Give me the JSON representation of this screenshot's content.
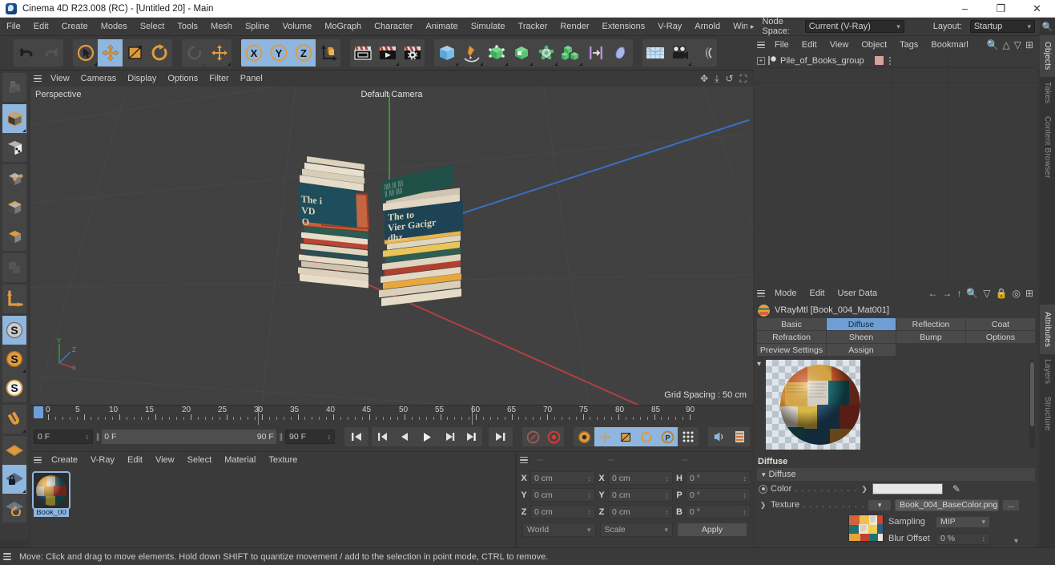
{
  "titlebar": {
    "title": "Cinema 4D R23.008 (RC) - [Untitled 20] - Main",
    "minimize": "–",
    "maximize": "❐",
    "close": "✕"
  },
  "menubar": {
    "items": [
      "File",
      "Edit",
      "Create",
      "Modes",
      "Select",
      "Tools",
      "Mesh",
      "Spline",
      "Volume",
      "MoGraph",
      "Character",
      "Animate",
      "Simulate",
      "Tracker",
      "Render",
      "Extensions",
      "V-Ray",
      "Arnold",
      "Wind"
    ],
    "overflow_arrow": "▸",
    "node_space_label": "Node Space:",
    "node_space_value": "Current (V-Ray)",
    "layout_label": "Layout:",
    "layout_value": "Startup",
    "search_icon": "search-icon"
  },
  "toolbar": {
    "icons": [
      {
        "name": "undo-icon",
        "sel": false,
        "dis": false
      },
      {
        "name": "redo-icon",
        "sel": false,
        "dis": true
      },
      {
        "name": "selection-tool-icon",
        "sel": false,
        "dis": false
      },
      {
        "name": "move-tool-icon",
        "sel": true,
        "dis": false
      },
      {
        "name": "scale-tool-icon",
        "sel": false,
        "dis": false
      },
      {
        "name": "rotate-tool-icon",
        "sel": false,
        "dis": false
      },
      {
        "name": "world-axis-icon",
        "sel": false,
        "dis": true
      },
      {
        "name": "coordinate-move-icon",
        "sel": false,
        "dis": false
      },
      {
        "name": "x-axis-lock-icon",
        "sel": true,
        "dis": false
      },
      {
        "name": "y-axis-lock-icon",
        "sel": true,
        "dis": false
      },
      {
        "name": "z-axis-lock-icon",
        "sel": true,
        "dis": false
      },
      {
        "name": "object-world-axis-icon",
        "sel": false,
        "dis": false
      },
      {
        "name": "render-view-icon",
        "sel": false,
        "dis": false
      },
      {
        "name": "render-to-picture-viewer-icon",
        "sel": false,
        "dis": false
      },
      {
        "name": "render-settings-icon",
        "sel": false,
        "dis": false
      },
      {
        "name": "cube-primitive-icon",
        "sel": false,
        "dis": false
      },
      {
        "name": "spline-pen-icon",
        "sel": false,
        "dis": false
      },
      {
        "name": "nurbs-generator-icon",
        "sel": false,
        "dis": false
      },
      {
        "name": "array-modeling-icon",
        "sel": false,
        "dis": false
      },
      {
        "name": "deformer-icon",
        "sel": false,
        "dis": false
      },
      {
        "name": "mograph-cloner-icon",
        "sel": false,
        "dis": false
      },
      {
        "name": "scene-nodes-icon",
        "sel": false,
        "dis": false
      },
      {
        "name": "light-icon",
        "sel": false,
        "dis": false
      },
      {
        "name": "floor-environment-icon",
        "sel": false,
        "dis": false
      },
      {
        "name": "camera-icon",
        "sel": false,
        "dis": false
      },
      {
        "name": "motion-tracker-icon",
        "sel": false,
        "dis": false
      }
    ]
  },
  "left_palette": {
    "groups": [
      [
        {
          "name": "point-mode-icon",
          "sel": false,
          "dis": true
        }
      ],
      [
        {
          "name": "model-mode-icon",
          "sel": true,
          "dis": false
        },
        {
          "name": "texture-mode-icon",
          "sel": false,
          "dis": false
        }
      ],
      [
        {
          "name": "point-edit-mode-icon",
          "sel": false,
          "dis": false
        },
        {
          "name": "edge-mode-icon",
          "sel": false,
          "dis": false
        },
        {
          "name": "polygon-mode-icon",
          "sel": false,
          "dis": false
        }
      ],
      [
        {
          "name": "uv-mode-icon",
          "sel": false,
          "dis": true
        }
      ],
      [
        {
          "name": "axis-modify-icon",
          "sel": false,
          "dis": false
        }
      ],
      [
        {
          "name": "enable-axis-icon",
          "sel": true,
          "dis": false
        },
        {
          "name": "lock-axis-icon",
          "sel": false,
          "dis": false
        },
        {
          "name": "viewport-solo-icon",
          "sel": false,
          "dis": false
        }
      ],
      [
        {
          "name": "snap-magnet-icon",
          "sel": false,
          "dis": false
        }
      ],
      [
        {
          "name": "workplane-icon",
          "sel": false,
          "dis": false
        },
        {
          "name": "workplane-lock-icon",
          "sel": true,
          "dis": false
        },
        {
          "name": "workplane-rotate-icon",
          "sel": false,
          "dis": false
        }
      ]
    ]
  },
  "viewport": {
    "menu": [
      "View",
      "Cameras",
      "Display",
      "Options",
      "Filter",
      "Panel"
    ],
    "corner_icons": [
      "pan-viewport-icon",
      "dolly-viewport-icon",
      "rotate-viewport-icon",
      "maximize-viewport-icon"
    ],
    "label": "Perspective",
    "camera": "Default Camera",
    "grid_spacing": "Grid Spacing : 50 cm",
    "axis_labels": {
      "y": "Y",
      "z": "Z",
      "x": "X"
    }
  },
  "timeline": {
    "ticks": [
      "0",
      "5",
      "10",
      "15",
      "20",
      "25",
      "30",
      "35",
      "40",
      "45",
      "50",
      "55",
      "60",
      "65",
      "70",
      "75",
      "80",
      "85",
      "90"
    ],
    "current_frame": "0 F",
    "range_start": "0 F",
    "range_end": "90 F",
    "max_frame": "90 F",
    "preview_frame": "0 F",
    "buttons": [
      {
        "name": "go-to-start-button",
        "glyph": "⏮"
      },
      {
        "name": "go-to-previous-key-button",
        "glyph": "⏮"
      },
      {
        "name": "step-back-button",
        "glyph": "◀"
      },
      {
        "name": "play-button",
        "glyph": "▶"
      },
      {
        "name": "step-forward-button",
        "glyph": "▶"
      },
      {
        "name": "go-to-next-key-button",
        "glyph": "⏭"
      },
      {
        "name": "go-to-end-button",
        "glyph": "⏭"
      }
    ],
    "record_tools": [
      {
        "name": "autokey-icon",
        "sel": false
      },
      {
        "name": "record-active-objects-icon",
        "sel": false
      },
      {
        "name": "keyframe-selection-icon",
        "sel": false
      },
      {
        "name": "position-key-icon",
        "sel": true
      },
      {
        "name": "scale-key-icon",
        "sel": true
      },
      {
        "name": "rotation-key-icon",
        "sel": true
      },
      {
        "name": "param-key-icon",
        "sel": true
      },
      {
        "name": "point-level-anim-icon",
        "sel": false
      },
      {
        "name": "sound-icon",
        "sel": false
      },
      {
        "name": "timeline-settings-icon",
        "sel": false
      }
    ]
  },
  "material_manager": {
    "menu": [
      "Create",
      "V-Ray",
      "Edit",
      "View",
      "Select",
      "Material",
      "Texture"
    ],
    "materials": [
      {
        "name": "Book_00",
        "selected": true
      }
    ]
  },
  "coordinates": {
    "columns": [
      "--",
      "--",
      "--"
    ],
    "rows": [
      {
        "l1": "X",
        "v1": "0 cm",
        "l2": "X",
        "v2": "0 cm",
        "l3": "H",
        "v3": "0 °"
      },
      {
        "l1": "Y",
        "v1": "0 cm",
        "l2": "Y",
        "v2": "0 cm",
        "l3": "P",
        "v3": "0 °"
      },
      {
        "l1": "Z",
        "v1": "0 cm",
        "l2": "Z",
        "v2": "0 cm",
        "l3": "B",
        "v3": "0 °"
      }
    ],
    "system": "World",
    "mode": "Scale",
    "apply": "Apply"
  },
  "statusbar": {
    "text": "Move: Click and drag to move elements. Hold down SHIFT to quantize movement / add to the selection in point mode, CTRL to remove."
  },
  "object_manager": {
    "menu": [
      "File",
      "Edit",
      "View",
      "Object",
      "Tags",
      "Bookmarks"
    ],
    "tools": [
      "search-icon",
      "home-icon",
      "filter-icon",
      "add-icon"
    ],
    "objects": [
      {
        "name": "Pile_of_Books_group",
        "expander": "+"
      }
    ]
  },
  "attributes": {
    "menu": [
      "Mode",
      "Edit",
      "User Data"
    ],
    "tools": [
      "back-arrow-icon",
      "forward-arrow-icon",
      "up-arrow-icon",
      "search-icon",
      "filter-icon",
      "lock-icon",
      "record-icon",
      "add-icon"
    ],
    "title": "VRayMtl [Book_004_Mat001]",
    "tabs_row1": [
      "Basic",
      "Diffuse",
      "Reflection",
      "Coat"
    ],
    "tabs_row2": [
      "Refraction",
      "Sheen",
      "Bump",
      "Options"
    ],
    "tabs_row3": [
      "Preview Settings",
      "Assign"
    ],
    "selected_tab": "Diffuse",
    "section_title": "Diffuse",
    "group_header": "Diffuse",
    "color_label": "Color",
    "color_dots": ". . . . . . . . . .",
    "color_value": "#e7e7e7",
    "texture_label": "Texture",
    "texture_dots": ". . . . . . . . . .",
    "texture_value": "Book_004_BaseColor.png",
    "texture_browse": "...",
    "sampling_label": "Sampling",
    "sampling_value": "MIP",
    "blur_offset_label": "Blur Offset",
    "blur_offset_value": "0 %"
  },
  "vertical_tabs": {
    "top": [
      "Objects",
      "Takes",
      "Content Browser"
    ],
    "top_selected": "Objects",
    "bottom": [
      "Attributes",
      "Layers",
      "Structure"
    ],
    "bottom_selected": "Attributes"
  },
  "colors": {
    "accent_blue": "#8fb6de",
    "panel_bg": "#3a3a3a",
    "viewport_bg": "#414141",
    "text": "#c8c8c8",
    "axis_x": "#b04040",
    "axis_y": "#3e8e3e",
    "axis_z": "#3a6fc4"
  }
}
